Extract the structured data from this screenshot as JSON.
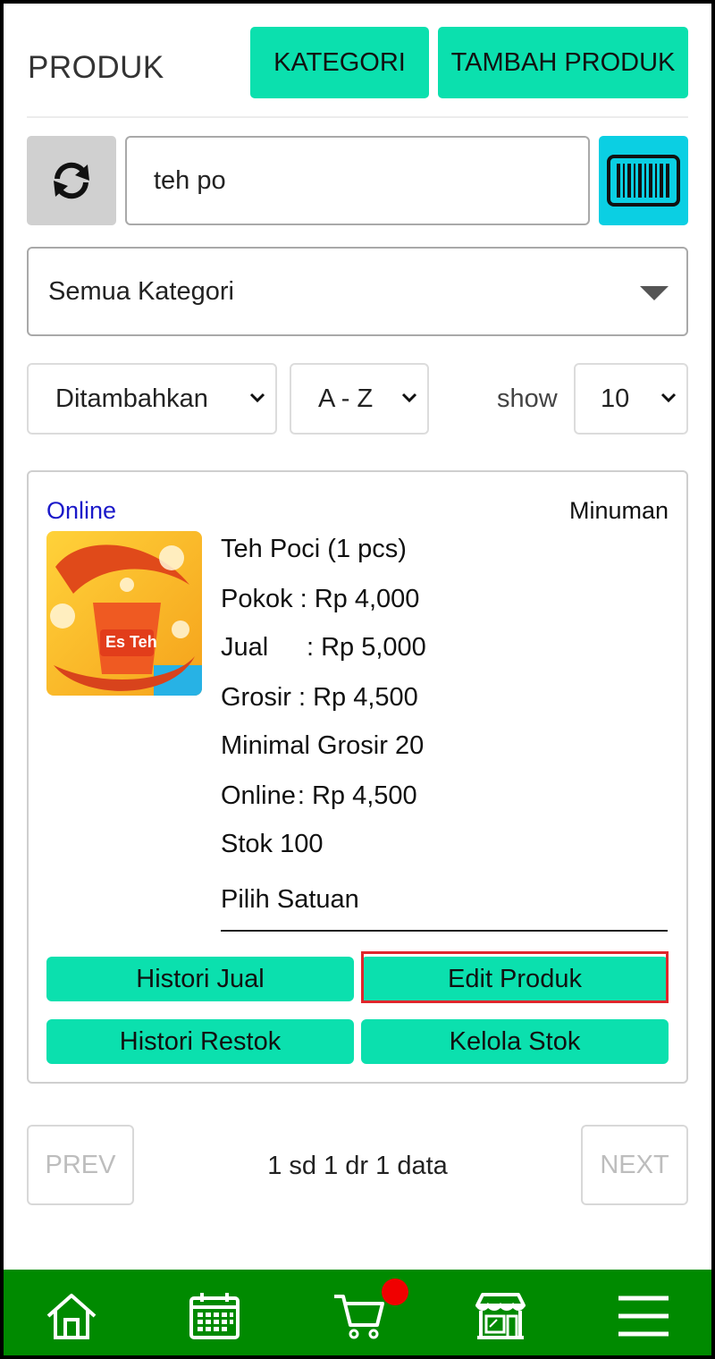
{
  "header": {
    "title": "PRODUK",
    "kategori_label": "KATEGORI",
    "tambah_label": "TAMBAH PRODUK"
  },
  "search": {
    "value": "teh po",
    "placeholder": ""
  },
  "filters": {
    "category": "Semua Kategori",
    "sort_by": "Ditambahkan",
    "order": "A - Z",
    "show_label": "show",
    "show_count": "10"
  },
  "product": {
    "status": "Online",
    "category": "Minuman",
    "name": "Teh Poci (1 pcs)",
    "pokok_label": "Pokok",
    "pokok_value": ": Rp 4,000",
    "jual_label": "Jual",
    "jual_value": ": Rp 5,000",
    "grosir_label": "Grosir",
    "grosir_value": ": Rp 4,500",
    "min_grosir": "Minimal Grosir 20",
    "online_label": "Online",
    "online_value": ": Rp 4,500",
    "stok": "Stok 100",
    "satuan_placeholder": "Pilih Satuan",
    "actions": {
      "histori_jual": "Histori Jual",
      "edit_produk": "Edit Produk",
      "histori_restok": "Histori Restok",
      "kelola_stok": "Kelola Stok"
    }
  },
  "pagination": {
    "prev": "PREV",
    "next": "NEXT",
    "info": "1 sd 1 dr 1 data"
  },
  "colors": {
    "accent": "#0be0ae",
    "barcode": "#0bcfe3",
    "nav": "#008a00",
    "highlight": "#e0262c",
    "status_online": "#1b19c9"
  },
  "nav": {
    "icons": [
      "home-icon",
      "calendar-icon",
      "cart-icon",
      "store-icon",
      "menu-icon"
    ]
  }
}
